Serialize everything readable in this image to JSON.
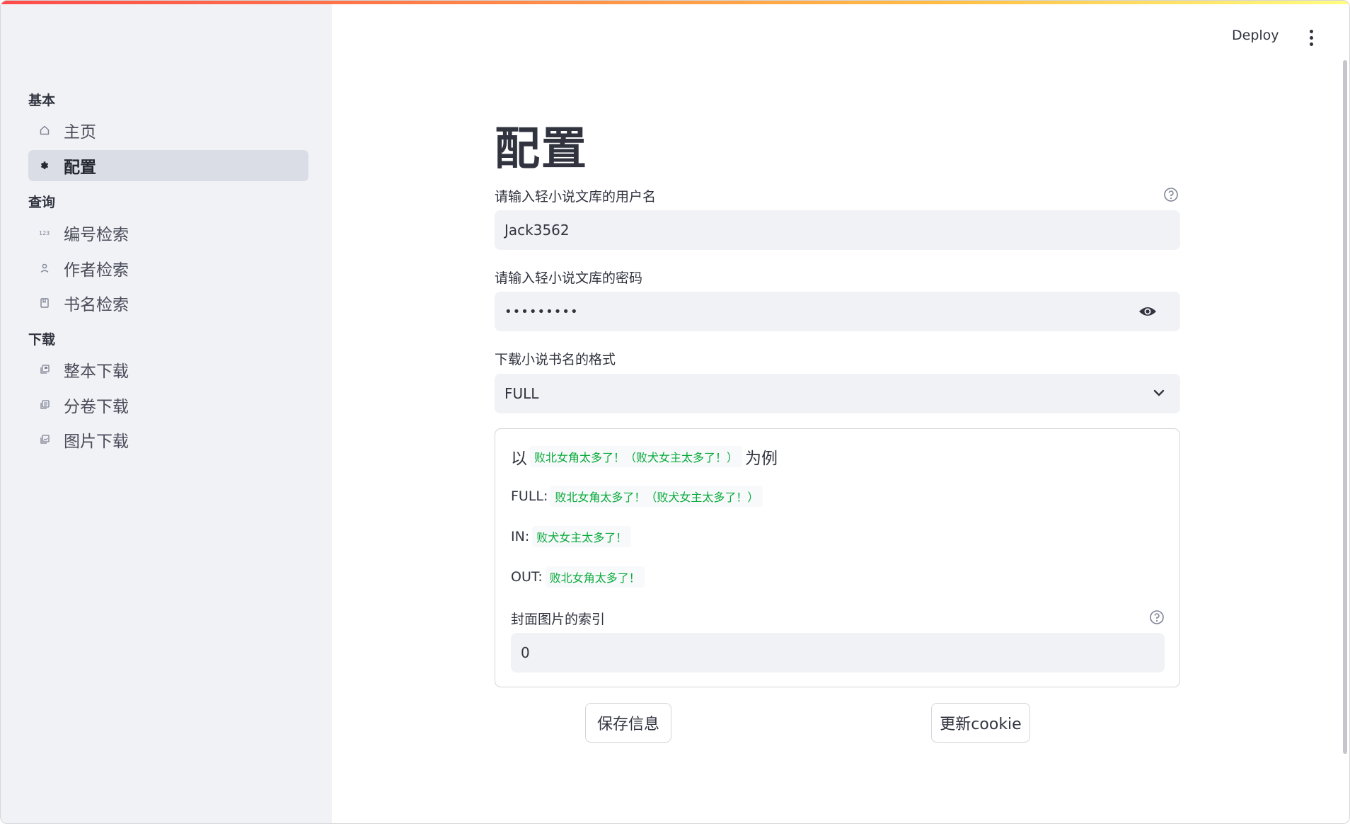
{
  "header": {
    "deploy_label": "Deploy"
  },
  "sidebar": {
    "sections": [
      {
        "title": "基本"
      },
      {
        "title": "查询"
      },
      {
        "title": "下载"
      }
    ],
    "items": [
      {
        "label": "主页",
        "icon": "home-icon"
      },
      {
        "label": "配置",
        "icon": "gear-icon",
        "active": true
      },
      {
        "label": "编号检索",
        "icon": "number-icon"
      },
      {
        "label": "作者检索",
        "icon": "person-icon"
      },
      {
        "label": "书名检索",
        "icon": "book-icon"
      },
      {
        "label": "整本下载",
        "icon": "library-icon"
      },
      {
        "label": "分卷下载",
        "icon": "volumes-icon"
      },
      {
        "label": "图片下载",
        "icon": "image-icon"
      }
    ]
  },
  "main": {
    "title": "配置",
    "username": {
      "label": "请输入轻小说文库的用户名",
      "value": "Jack3562"
    },
    "password": {
      "label": "请输入轻小说文库的密码",
      "value": "•••••••••"
    },
    "format": {
      "label": "下载小说书名的格式",
      "selected": "FULL"
    },
    "example": {
      "prefix": "以",
      "full_title": "败北女角太多了！（败犬女主太多了！）",
      "suffix": "为例",
      "rows": [
        {
          "key": "FULL:",
          "value": "败北女角太多了！（败犬女主太多了！）"
        },
        {
          "key": "IN:",
          "value": "败犬女主太多了！"
        },
        {
          "key": "OUT:",
          "value": "败北女角太多了！"
        }
      ]
    },
    "cover_index": {
      "label": "封面图片的索引",
      "value": "0"
    },
    "save_label": "保存信息",
    "cookie_label": "更新cookie"
  },
  "colors": {
    "accent": "#ff4b4b",
    "code_text": "#09ab3b",
    "sidebar_bg": "#f0f2f6"
  }
}
